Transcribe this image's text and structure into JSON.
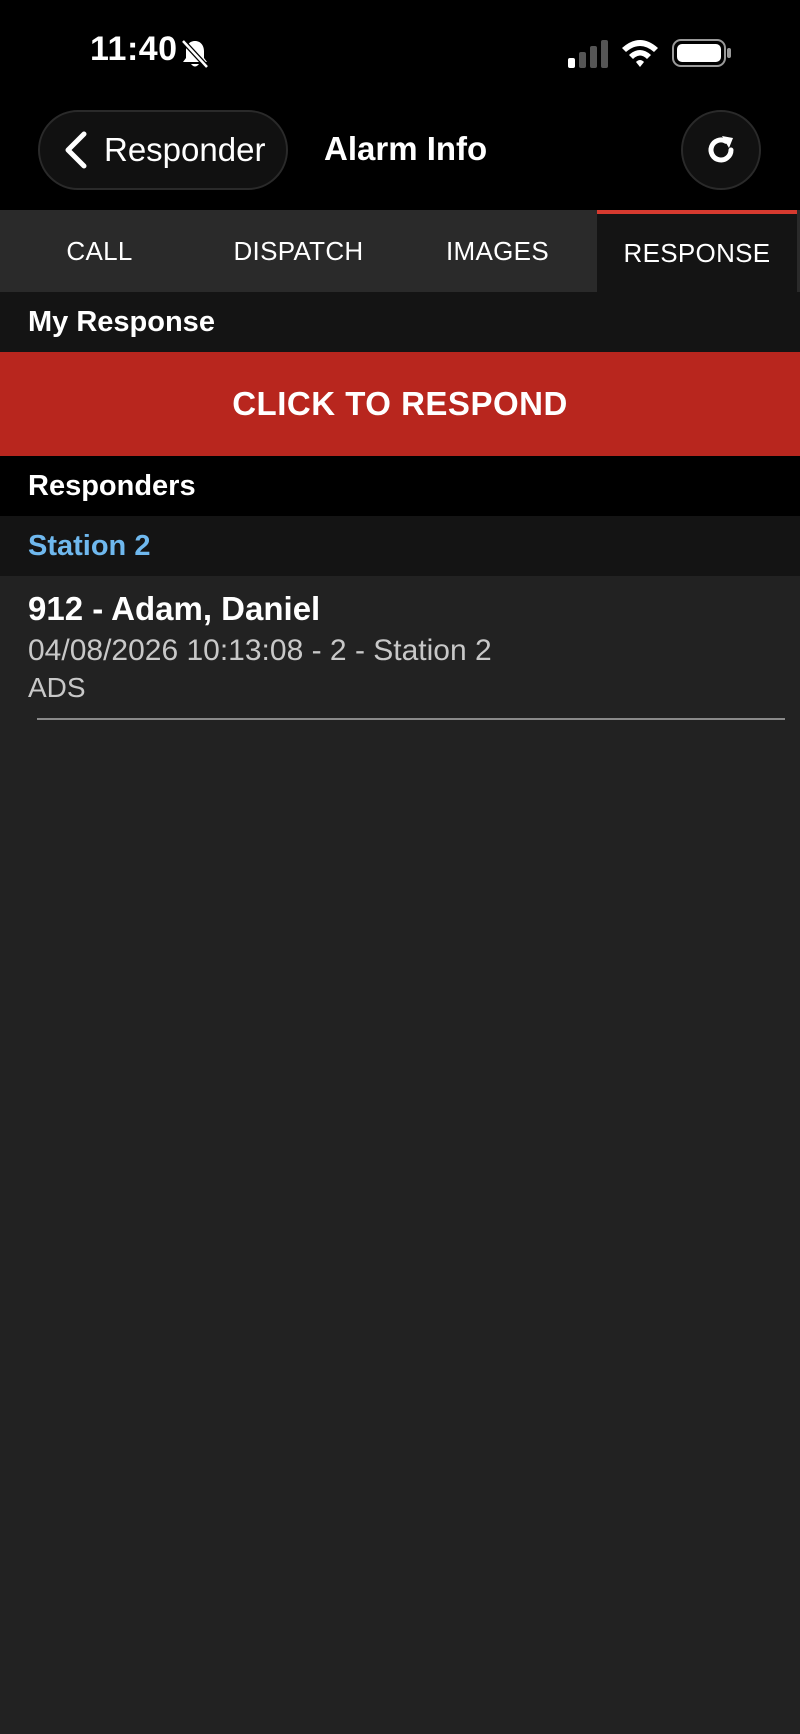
{
  "status_bar": {
    "time": "11:40",
    "icons": [
      "bell-slash-icon",
      "cellular-signal-icon",
      "wifi-icon",
      "battery-icon"
    ]
  },
  "nav": {
    "back_label": "Responder",
    "title": "Alarm Info",
    "refresh_icon": "refresh-icon"
  },
  "tabs": [
    {
      "label": "CALL",
      "active": false
    },
    {
      "label": "DISPATCH",
      "active": false
    },
    {
      "label": "IMAGES",
      "active": false
    },
    {
      "label": "RESPONSE",
      "active": true
    }
  ],
  "my_response": {
    "header": "My Response",
    "button_label": "CLICK TO RESPOND"
  },
  "responders": {
    "header": "Responders",
    "groups": [
      {
        "station": "Station 2",
        "items": [
          {
            "name": "912 - Adam, Daniel",
            "detail": "04/08/2026 10:13:08 - 2 - Station 2",
            "code": "ADS"
          }
        ]
      }
    ]
  },
  "colors": {
    "accent_red": "#b8261e",
    "tab_indicator": "#d63a2f",
    "station_blue": "#6fb8ee",
    "background": "#222222"
  }
}
